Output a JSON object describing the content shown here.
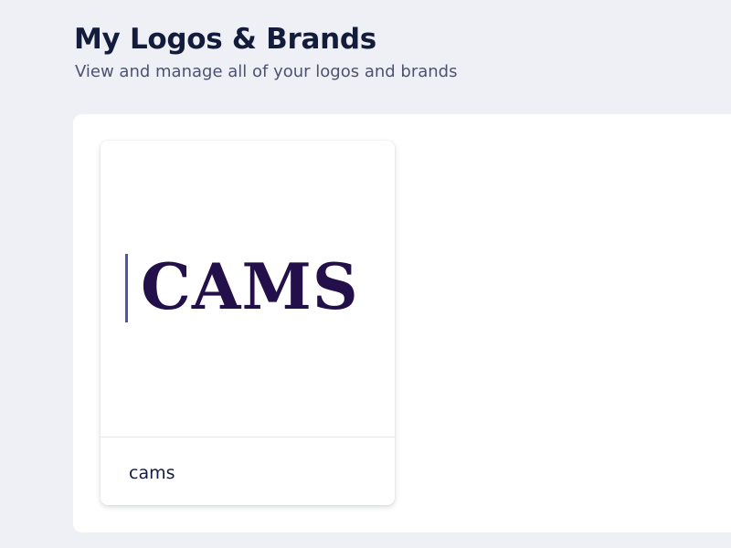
{
  "header": {
    "title": "My Logos & Brands",
    "subtitle": "View and manage all of your logos and brands"
  },
  "logos": [
    {
      "logo_text": "CAMS",
      "name": "cams"
    }
  ],
  "colors": {
    "background": "#eef0f5",
    "panel": "#ffffff",
    "title": "#131d3b",
    "subtitle": "#4b5370",
    "logo_text": "#230f49",
    "logo_bar": "#4e56a8"
  }
}
